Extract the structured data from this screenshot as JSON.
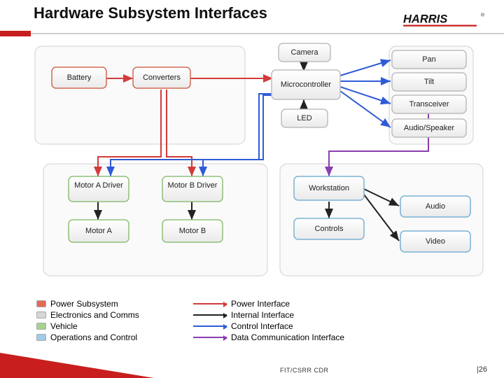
{
  "header": {
    "title": "Hardware Subsystem Interfaces",
    "logo_text": "HARRIS",
    "logo_trademark": "®"
  },
  "legend_subsystems": [
    {
      "label": "Power Subsystem",
      "color": "#e46a57"
    },
    {
      "label": "Electronics and Comms",
      "color": "#d6d6d6"
    },
    {
      "label": "Vehicle",
      "color": "#a5d38e"
    },
    {
      "label": "Operations and Control",
      "color": "#9fcbe8"
    }
  ],
  "legend_interfaces": [
    {
      "label": "Power Interface",
      "color": "#d23b3b"
    },
    {
      "label": "Internal Interface",
      "color": "#222222"
    },
    {
      "label": "Control Interface",
      "color": "#2f5bd6"
    },
    {
      "label": "Data Communication Interface",
      "color": "#8a3fb0"
    }
  ],
  "nodes": {
    "battery": "Battery",
    "converters": "Converters",
    "camera": "Camera",
    "microcontroller": "Microcontroller",
    "led": "LED",
    "pan": "Pan",
    "tilt": "Tilt",
    "transceiver": "Transceiver",
    "audio_speaker": "Audio/Speaker",
    "motor_a_driver": "Motor A Driver",
    "motor_b_driver": "Motor B Driver",
    "motor_a": "Motor A",
    "motor_b": "Motor B",
    "workstation": "Workstation",
    "controls": "Controls",
    "audio": "Audio",
    "video": "Video"
  },
  "footer": {
    "copy": "FIT/CSRR CDR",
    "page": "|26"
  }
}
